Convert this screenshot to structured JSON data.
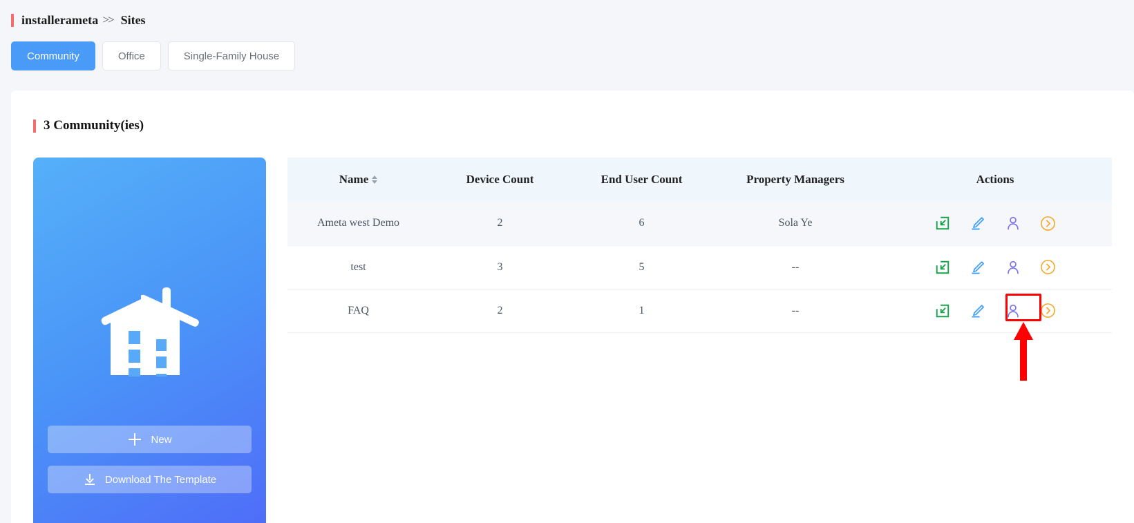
{
  "breadcrumb": {
    "root": "installerameta",
    "separator": ">>",
    "current": "Sites"
  },
  "tabs": [
    {
      "label": "Community",
      "active": true
    },
    {
      "label": "Office",
      "active": false
    },
    {
      "label": "Single-Family House",
      "active": false
    }
  ],
  "section": {
    "title": "3 Community(ies)",
    "accent_color": "#f56c6c"
  },
  "promo_card": {
    "illustration": "building-icon",
    "gradient_from": "#56b0f9",
    "gradient_to": "#4f6df8",
    "buttons": [
      {
        "label": "New",
        "icon": "plus-icon"
      },
      {
        "label": "Download The Template",
        "icon": "download-icon"
      }
    ]
  },
  "table": {
    "columns": [
      {
        "label": "Name",
        "sortable": true
      },
      {
        "label": "Device Count",
        "sortable": false
      },
      {
        "label": "End User Count",
        "sortable": false
      },
      {
        "label": "Property Managers",
        "sortable": false
      },
      {
        "label": "Actions",
        "sortable": false
      }
    ],
    "rows": [
      {
        "name": "Ameta west Demo",
        "device_count": "2",
        "end_user_count": "6",
        "property_managers": "Sola Ye"
      },
      {
        "name": "test",
        "device_count": "3",
        "end_user_count": "5",
        "property_managers": "--"
      },
      {
        "name": "FAQ",
        "device_count": "2",
        "end_user_count": "1",
        "property_managers": "--"
      }
    ],
    "action_icons": [
      {
        "name": "import-icon",
        "color": "#16a34a"
      },
      {
        "name": "edit-pencil-icon",
        "color": "#3b9dfb"
      },
      {
        "name": "user-icon",
        "color": "#7b72e8"
      },
      {
        "name": "chevron-right-circle-icon",
        "color": "#f5a623"
      }
    ]
  },
  "annotation": {
    "highlight_color": "#ff0000",
    "target": "chevron-right-circle-icon-row-3"
  }
}
